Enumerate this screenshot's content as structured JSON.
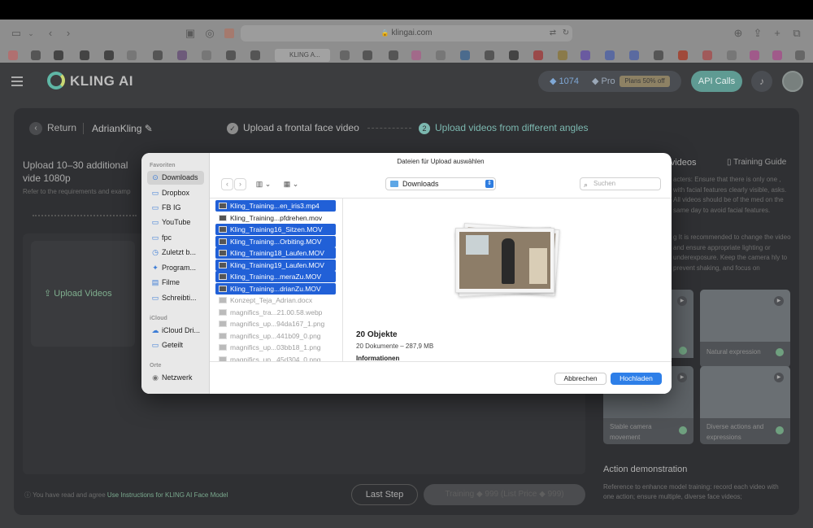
{
  "browser": {
    "url": "klingai.com",
    "active_tab": "KLING A..."
  },
  "app": {
    "logo_text": "KLING AI",
    "credits": "1074",
    "pro_label": "Pro",
    "plans_badge": "Plans 50% off",
    "api_calls": "API Calls"
  },
  "header": {
    "return_label": "Return",
    "user_name": "AdrianKling",
    "step1_number": "✓",
    "step1_label": "Upload a frontal face video",
    "step2_number": "2",
    "step2_label": "Upload videos from different angles"
  },
  "upload_panel": {
    "title": "Upload 10–30 additional vide 1080p",
    "subtitle": "Refer to the requirements and examp",
    "upload_button": "Upload Videos"
  },
  "right_panel": {
    "title": "r videos",
    "guide": "Training Guide",
    "text1": "acters: Ensure that there is only one , with facial features clearly visible, asks. All videos should be of the med on the same day to avoid facial features.",
    "text2": "g It is recommended to change the video and ensure appropriate lighting or underexposure. Keep the camera hly to prevent shaking, and focus on",
    "thumbs": [
      {
        "caption": "Natural expression"
      },
      {
        "caption": "Stable camera movement"
      },
      {
        "caption": "Diverse actions and expressions"
      }
    ],
    "action_title": "Action demonstration",
    "action_text": "Reference to enhance model training: record each video with one action; ensure multiple, diverse face videos;"
  },
  "footer": {
    "agree_text": "You have read and agree ",
    "agree_link": "Use Instructions for KLING AI Face Model",
    "last_step": "Last Step",
    "training": "Training ◆ 999  (List Price ◆ 999)"
  },
  "dialog": {
    "title": "Dateien für Upload auswählen",
    "current_folder": "Downloads",
    "search_placeholder": "Suchen",
    "sidebar": {
      "favorites_header": "Favoriten",
      "favorites": [
        "Downloads",
        "Dropbox",
        "FB IG",
        "YouTube",
        "fpc",
        "Zuletzt b...",
        "Program...",
        "Filme",
        "Schreibti..."
      ],
      "icloud_header": "iCloud",
      "icloud": [
        "iCloud Dri...",
        "Geteilt"
      ],
      "places_header": "Orte",
      "places": [
        "Netzwerk"
      ]
    },
    "files": [
      {
        "name": "Kling_Training...en_iris3.mp4",
        "state": "sel"
      },
      {
        "name": "Kling_Training...pfdrehen.mov",
        "state": "normal"
      },
      {
        "name": "Kling_Training16_Sitzen.MOV",
        "state": "sel"
      },
      {
        "name": "Kling_Training...Orbiting.MOV",
        "state": "sel"
      },
      {
        "name": "Kling_Training18_Laufen.MOV",
        "state": "sel"
      },
      {
        "name": "Kling_Training19_Laufen.MOV",
        "state": "sel"
      },
      {
        "name": "Kling_Training...meraZu.MOV",
        "state": "sel"
      },
      {
        "name": "Kling_Training...drianZu.MOV",
        "state": "sel"
      },
      {
        "name": "Konzept_Teja_Adrian.docx",
        "state": "dim"
      },
      {
        "name": "magnifics_tra...21.00.58.webp",
        "state": "dim"
      },
      {
        "name": "magnifics_up...94da167_1.png",
        "state": "dim"
      },
      {
        "name": "magnifics_up...441b09_0.png",
        "state": "dim"
      },
      {
        "name": "magnifics_up...03bb18_1.png",
        "state": "dim"
      },
      {
        "name": "magnifics_up...45d304_0.png",
        "state": "dim"
      }
    ],
    "object_count": "20 Objekte",
    "object_details": "20 Dokumente – 287,9 MB",
    "info_label": "Informationen",
    "cancel_button": "Abbrechen",
    "upload_button": "Hochladen"
  }
}
